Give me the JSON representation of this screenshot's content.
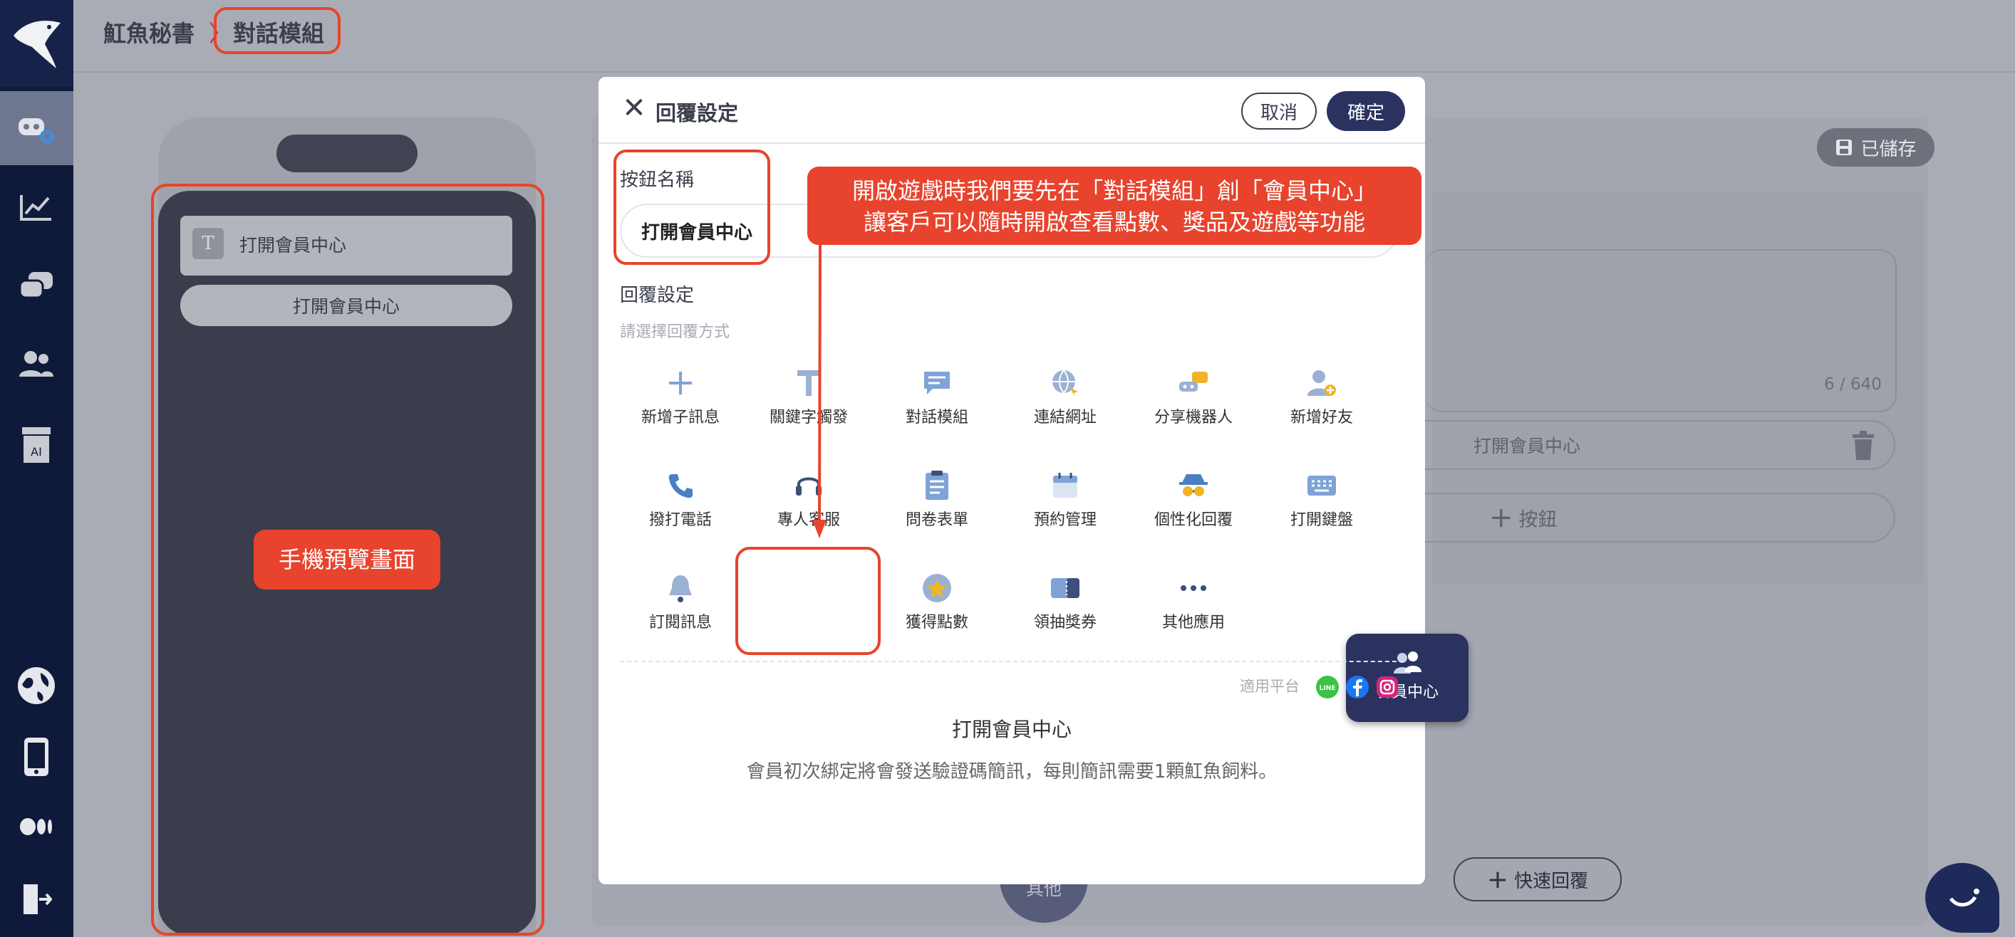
{
  "breadcrumb": {
    "root": "魟魚秘書",
    "separator": "〉",
    "current": "對話模組"
  },
  "phone": {
    "card_icon_letter": "T",
    "card_text": "打開會員中心",
    "button_text": "打開會員中心"
  },
  "editor": {
    "saved_label": "已儲存",
    "counter": "6 / 640",
    "button_text": "打開會員中心",
    "add_button_label": "按鈕",
    "quick_reply_label": "快速回覆",
    "other_tab_label": "其他"
  },
  "modal": {
    "title": "回覆設定",
    "cancel_label": "取消",
    "confirm_label": "確定",
    "name_label": "按鈕名稱",
    "name_value": "打開會員中心",
    "reply_label": "回覆設定",
    "reply_hint": "請選擇回覆方式",
    "options": [
      {
        "label": "新增子訊息",
        "icon": "plus-icon"
      },
      {
        "label": "關鍵字觸發",
        "icon": "text-t-icon"
      },
      {
        "label": "對話模組",
        "icon": "chat-module-icon"
      },
      {
        "label": "連結網址",
        "icon": "globe-link-icon"
      },
      {
        "label": "分享機器人",
        "icon": "share-bot-icon"
      },
      {
        "label": "新增好友",
        "icon": "add-friend-icon"
      },
      {
        "label": "撥打電話",
        "icon": "phone-icon"
      },
      {
        "label": "專人客服",
        "icon": "headset-icon"
      },
      {
        "label": "問卷表單",
        "icon": "form-icon"
      },
      {
        "label": "預約管理",
        "icon": "calendar-icon"
      },
      {
        "label": "個性化回覆",
        "icon": "spy-icon"
      },
      {
        "label": "打開鍵盤",
        "icon": "keyboard-icon"
      },
      {
        "label": "訂閱訊息",
        "icon": "bell-icon"
      },
      {
        "label": "會員中心",
        "icon": "members-icon",
        "selected": true
      },
      {
        "label": "獲得點數",
        "icon": "star-coin-icon"
      },
      {
        "label": "領抽獎券",
        "icon": "ticket-icon"
      },
      {
        "label": "其他應用",
        "icon": "more-dots-icon"
      }
    ],
    "platform_label": "適用平台",
    "platforms": [
      "LINE",
      "Facebook",
      "Instagram"
    ],
    "detail_title": "打開會員中心",
    "detail_desc": "會員初次綁定將會發送驗證碼簡訊，每則簡訊需要1顆魟魚飼料。"
  },
  "annotations": {
    "callout_line1": "開啟遊戲時我們要先在「對話模組」創「會員中心」",
    "callout_line2": "讓客戶可以隨時開啟查看點數、獎品及遊戲等功能",
    "phone_preview": "手機預覽畫面"
  },
  "colors": {
    "navy": "#2b3260",
    "accent_red": "#e8432d",
    "sidebar": "#0f1a3a"
  }
}
